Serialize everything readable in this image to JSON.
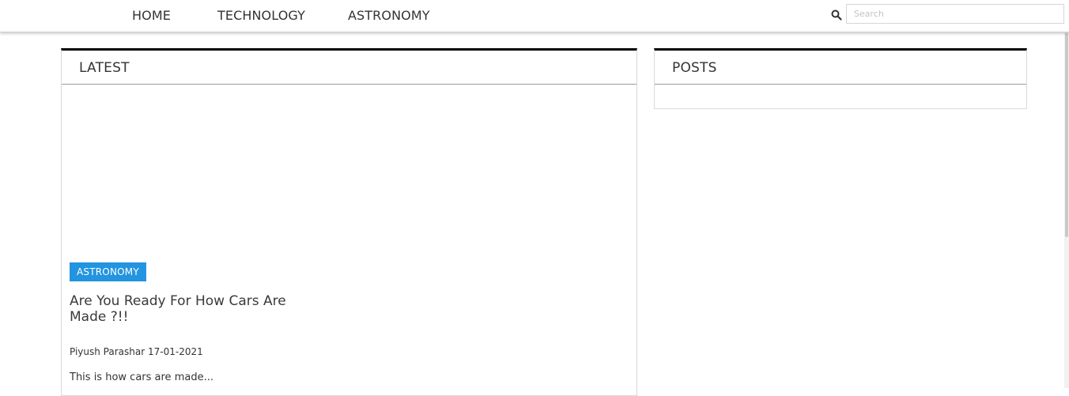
{
  "nav": {
    "items": [
      {
        "label": "HOME"
      },
      {
        "label": "TECHNOLOGY"
      },
      {
        "label": "ASTRONOMY"
      }
    ],
    "search_placeholder": "Search",
    "search_icon": "search-icon"
  },
  "latest": {
    "title": "LATEST",
    "post": {
      "category": "ASTRONOMY",
      "title": "Are You Ready For How Cars Are Made ?!!",
      "author": "Piyush Parashar",
      "date": "17-01-2021",
      "excerpt": "This is how cars are made..."
    }
  },
  "posts": {
    "title": "POSTS"
  },
  "colors": {
    "accent": "#2394e0",
    "panel_top_border": "#000000",
    "text": "#333333"
  }
}
